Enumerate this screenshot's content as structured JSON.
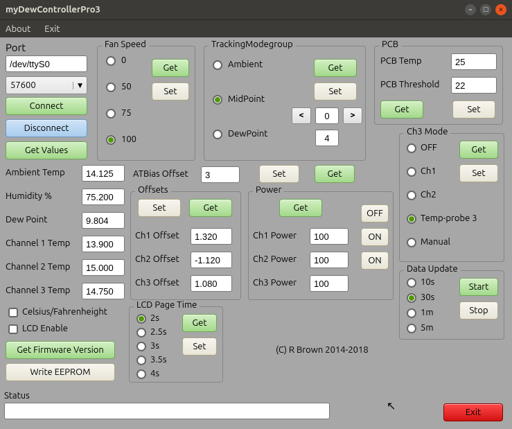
{
  "window": {
    "title": "myDewControllerPro3"
  },
  "menu": {
    "about": "About",
    "exit": "Exit"
  },
  "port": {
    "label": "Port",
    "device": "/dev/ttyS0",
    "baud": "57600",
    "connect": "Connect",
    "disconnect": "Disconnect",
    "getvalues": "Get Values"
  },
  "readings": {
    "ambient_l": "Ambient Temp",
    "ambient_v": "14.125",
    "humid_l": "Humidity %",
    "humid_v": "75.200",
    "dew_l": "Dew Point",
    "dew_v": "9.804",
    "c1_l": "Channel 1 Temp",
    "c1_v": "13.900",
    "c2_l": "Channel 2 Temp",
    "c2_v": "15.000",
    "c3_l": "Channel 3 Temp",
    "c3_v": "14.750"
  },
  "cf_label": "Celsius/Fahrenheight",
  "lcd_label": "LCD Enable",
  "fw_btn": "Get Firmware Version",
  "eeprom_btn": "Write EEPROM",
  "fanspeed": {
    "title": "Fan Speed",
    "o0": "0",
    "o50": "50",
    "o75": "75",
    "o100": "100",
    "get": "Get",
    "set": "Set"
  },
  "tracking": {
    "title": "TrackingModegroup",
    "ambient": "Ambient",
    "midpoint": "MidPoint",
    "dewpoint": "DewPoint",
    "get": "Get",
    "set": "Set",
    "center": "0",
    "below": "4"
  },
  "atbias": {
    "label": "ATBias Offset",
    "val": "3",
    "set": "Set",
    "get": "Get"
  },
  "offsets": {
    "title": "Offsets",
    "set": "Set",
    "get": "Get",
    "c1_l": "Ch1 Offset",
    "c1_v": "1.320",
    "c2_l": "Ch2 Offset",
    "c2_v": "-1.120",
    "c3_l": "Ch3 Offset",
    "c3_v": "1.080"
  },
  "power": {
    "title": "Power",
    "get": "Get",
    "off": "OFF",
    "on": "ON",
    "c1_l": "Ch1 Power",
    "c1_v": "100",
    "c2_l": "Ch2 Power",
    "c2_v": "100",
    "c3_l": "Ch3 Power",
    "c3_v": "100"
  },
  "lcdpage": {
    "title": "LCD Page Time",
    "o2": "2s",
    "o25": "2.5s",
    "o3": "3s",
    "o35": "3.5s",
    "o4": "4s",
    "get": "Get",
    "set": "Set"
  },
  "pcb": {
    "title": "PCB",
    "temp_l": "PCB Temp",
    "temp_v": "25",
    "thr_l": "PCB Threshold",
    "thr_v": "22",
    "get": "Get",
    "set": "Set"
  },
  "ch3mode": {
    "title": "Ch3 Mode",
    "off": "OFF",
    "ch1": "Ch1",
    "ch2": "Ch2",
    "tp3": "Temp-probe 3",
    "man": "Manual",
    "get": "Get",
    "set": "Set"
  },
  "update": {
    "title": "Data Update",
    "o10": "10s",
    "o30": "30s",
    "o1m": "1m",
    "o5m": "5m",
    "start": "Start",
    "stop": "Stop"
  },
  "copyright": "(C) R Brown 2014-2018",
  "status_label": "Status",
  "exit_btn": "Exit"
}
